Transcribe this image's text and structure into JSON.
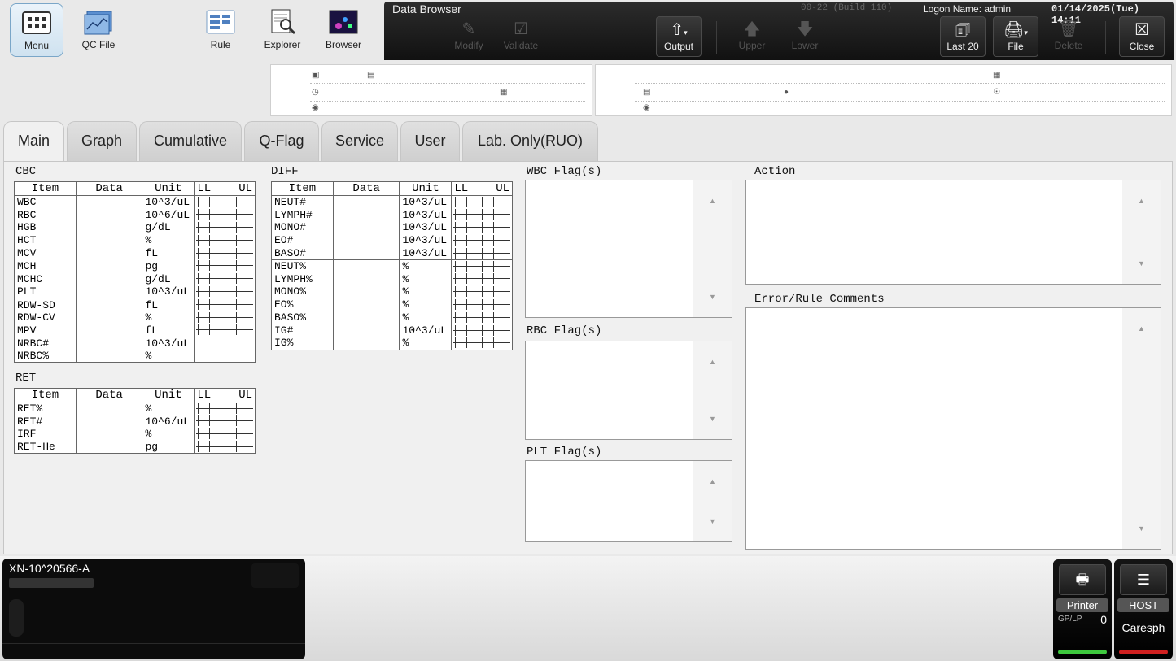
{
  "launcher": {
    "menu": "Menu",
    "qc_file": "QC File",
    "rule": "Rule",
    "explorer": "Explorer",
    "browser": "Browser"
  },
  "toolbar": {
    "title": "Data Browser",
    "build": "00-22 (Build 110)",
    "logon": "Logon Name: admin",
    "datetime": "01/14/2025(Tue) 14:11",
    "modify": "Modify",
    "validate": "Validate",
    "output": "Output",
    "upper": "Upper",
    "lower": "Lower",
    "last20": "Last 20",
    "file": "File",
    "delete": "Delete",
    "close": "Close"
  },
  "info_left_icons": [
    "pc-icon",
    "no-icon",
    "clock-icon",
    "calendar-icon",
    "comment-icon"
  ],
  "info_right_icons": [
    "hospital-icon",
    "id-icon",
    "person-icon",
    "doctor-icon",
    "comment-icon"
  ],
  "tabs": [
    "Main",
    "Graph",
    "Cumulative",
    "Q-Flag",
    "Service",
    "User",
    "Lab. Only(RUO)"
  ],
  "cbc": {
    "label": "CBC",
    "headers": [
      "Item",
      "Data",
      "Unit",
      "LL",
      "UL"
    ],
    "groups": [
      [
        [
          "WBC",
          "10^3/uL"
        ],
        [
          "RBC",
          "10^6/uL"
        ],
        [
          "HGB",
          "g/dL"
        ],
        [
          "HCT",
          "%"
        ],
        [
          "MCV",
          "fL"
        ],
        [
          "MCH",
          "pg"
        ],
        [
          "MCHC",
          "g/dL"
        ],
        [
          "PLT",
          "10^3/uL"
        ]
      ],
      [
        [
          "RDW-SD",
          "fL"
        ],
        [
          "RDW-CV",
          "%"
        ],
        [
          "MPV",
          "fL"
        ]
      ],
      [
        [
          "NRBC#",
          "10^3/uL"
        ],
        [
          "NRBC%",
          "%"
        ]
      ]
    ]
  },
  "ret": {
    "label": "RET",
    "headers": [
      "Item",
      "Data",
      "Unit",
      "LL",
      "UL"
    ],
    "groups": [
      [
        [
          "RET%",
          "%"
        ],
        [
          "RET#",
          "10^6/uL"
        ],
        [
          "IRF",
          "%"
        ],
        [
          "RET-He",
          "pg"
        ]
      ]
    ]
  },
  "diff": {
    "label": "DIFF",
    "headers": [
      "Item",
      "Data",
      "Unit",
      "LL",
      "UL"
    ],
    "groups": [
      [
        [
          "NEUT#",
          "10^3/uL"
        ],
        [
          "LYMPH#",
          "10^3/uL"
        ],
        [
          "MONO#",
          "10^3/uL"
        ],
        [
          "EO#",
          "10^3/uL"
        ],
        [
          "BASO#",
          "10^3/uL"
        ]
      ],
      [
        [
          "NEUT%",
          "%"
        ],
        [
          "LYMPH%",
          "%"
        ],
        [
          "MONO%",
          "%"
        ],
        [
          "EO%",
          "%"
        ],
        [
          "BASO%",
          "%"
        ]
      ],
      [
        [
          "IG#",
          "10^3/uL"
        ],
        [
          "IG%",
          "%"
        ]
      ]
    ]
  },
  "flags": {
    "wbc": "WBC Flag(s)",
    "rbc": "RBC Flag(s)",
    "plt": "PLT Flag(s)",
    "action": "Action",
    "comments": "Error/Rule Comments"
  },
  "instrument": {
    "name": "XN-10^20566-A"
  },
  "status": {
    "printer": "Printer",
    "gplp": "GP/LP",
    "printer_count": "0",
    "host": "HOST",
    "host_name": "Caresph",
    "printer_color": "#3ec83e",
    "host_color": "#d02020"
  }
}
